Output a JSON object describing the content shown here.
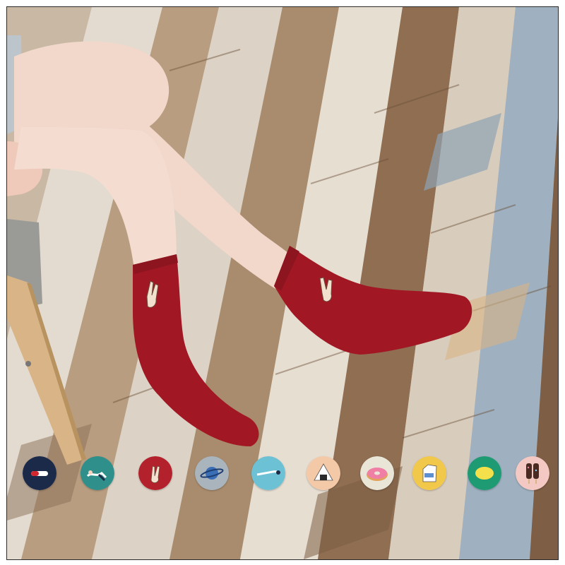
{
  "scene": {
    "subject": "legs",
    "colors": {
      "floor_light": "#d9cfc2",
      "floor_mid": "#b59a7c",
      "floor_dark": "#7e5e44",
      "floor_blue": "#8fa2b4",
      "skin": "#f2d7cb",
      "sock": "#a11824",
      "chair_wood": "#d9b486",
      "chair_seat": "#9a9a96"
    }
  },
  "swatches": [
    {
      "icon": "pill-icon",
      "bg": "#1c2a4a"
    },
    {
      "icon": "swimmer-icon",
      "bg": "#2f8f8a"
    },
    {
      "icon": "hand-sign-icon",
      "bg": "#b3212c"
    },
    {
      "icon": "planet-icon",
      "bg": "#aab4bc"
    },
    {
      "icon": "diver-icon",
      "bg": "#6cc1d4"
    },
    {
      "icon": "rice-ball-icon",
      "bg": "#f3c9a8"
    },
    {
      "icon": "donut-icon",
      "bg": "#e9e6d8"
    },
    {
      "icon": "milk-carton-icon",
      "bg": "#f2c84a"
    },
    {
      "icon": "lemon-icon",
      "bg": "#1f9b74"
    },
    {
      "icon": "popsicle-icon",
      "bg": "#f4c9c4"
    }
  ]
}
